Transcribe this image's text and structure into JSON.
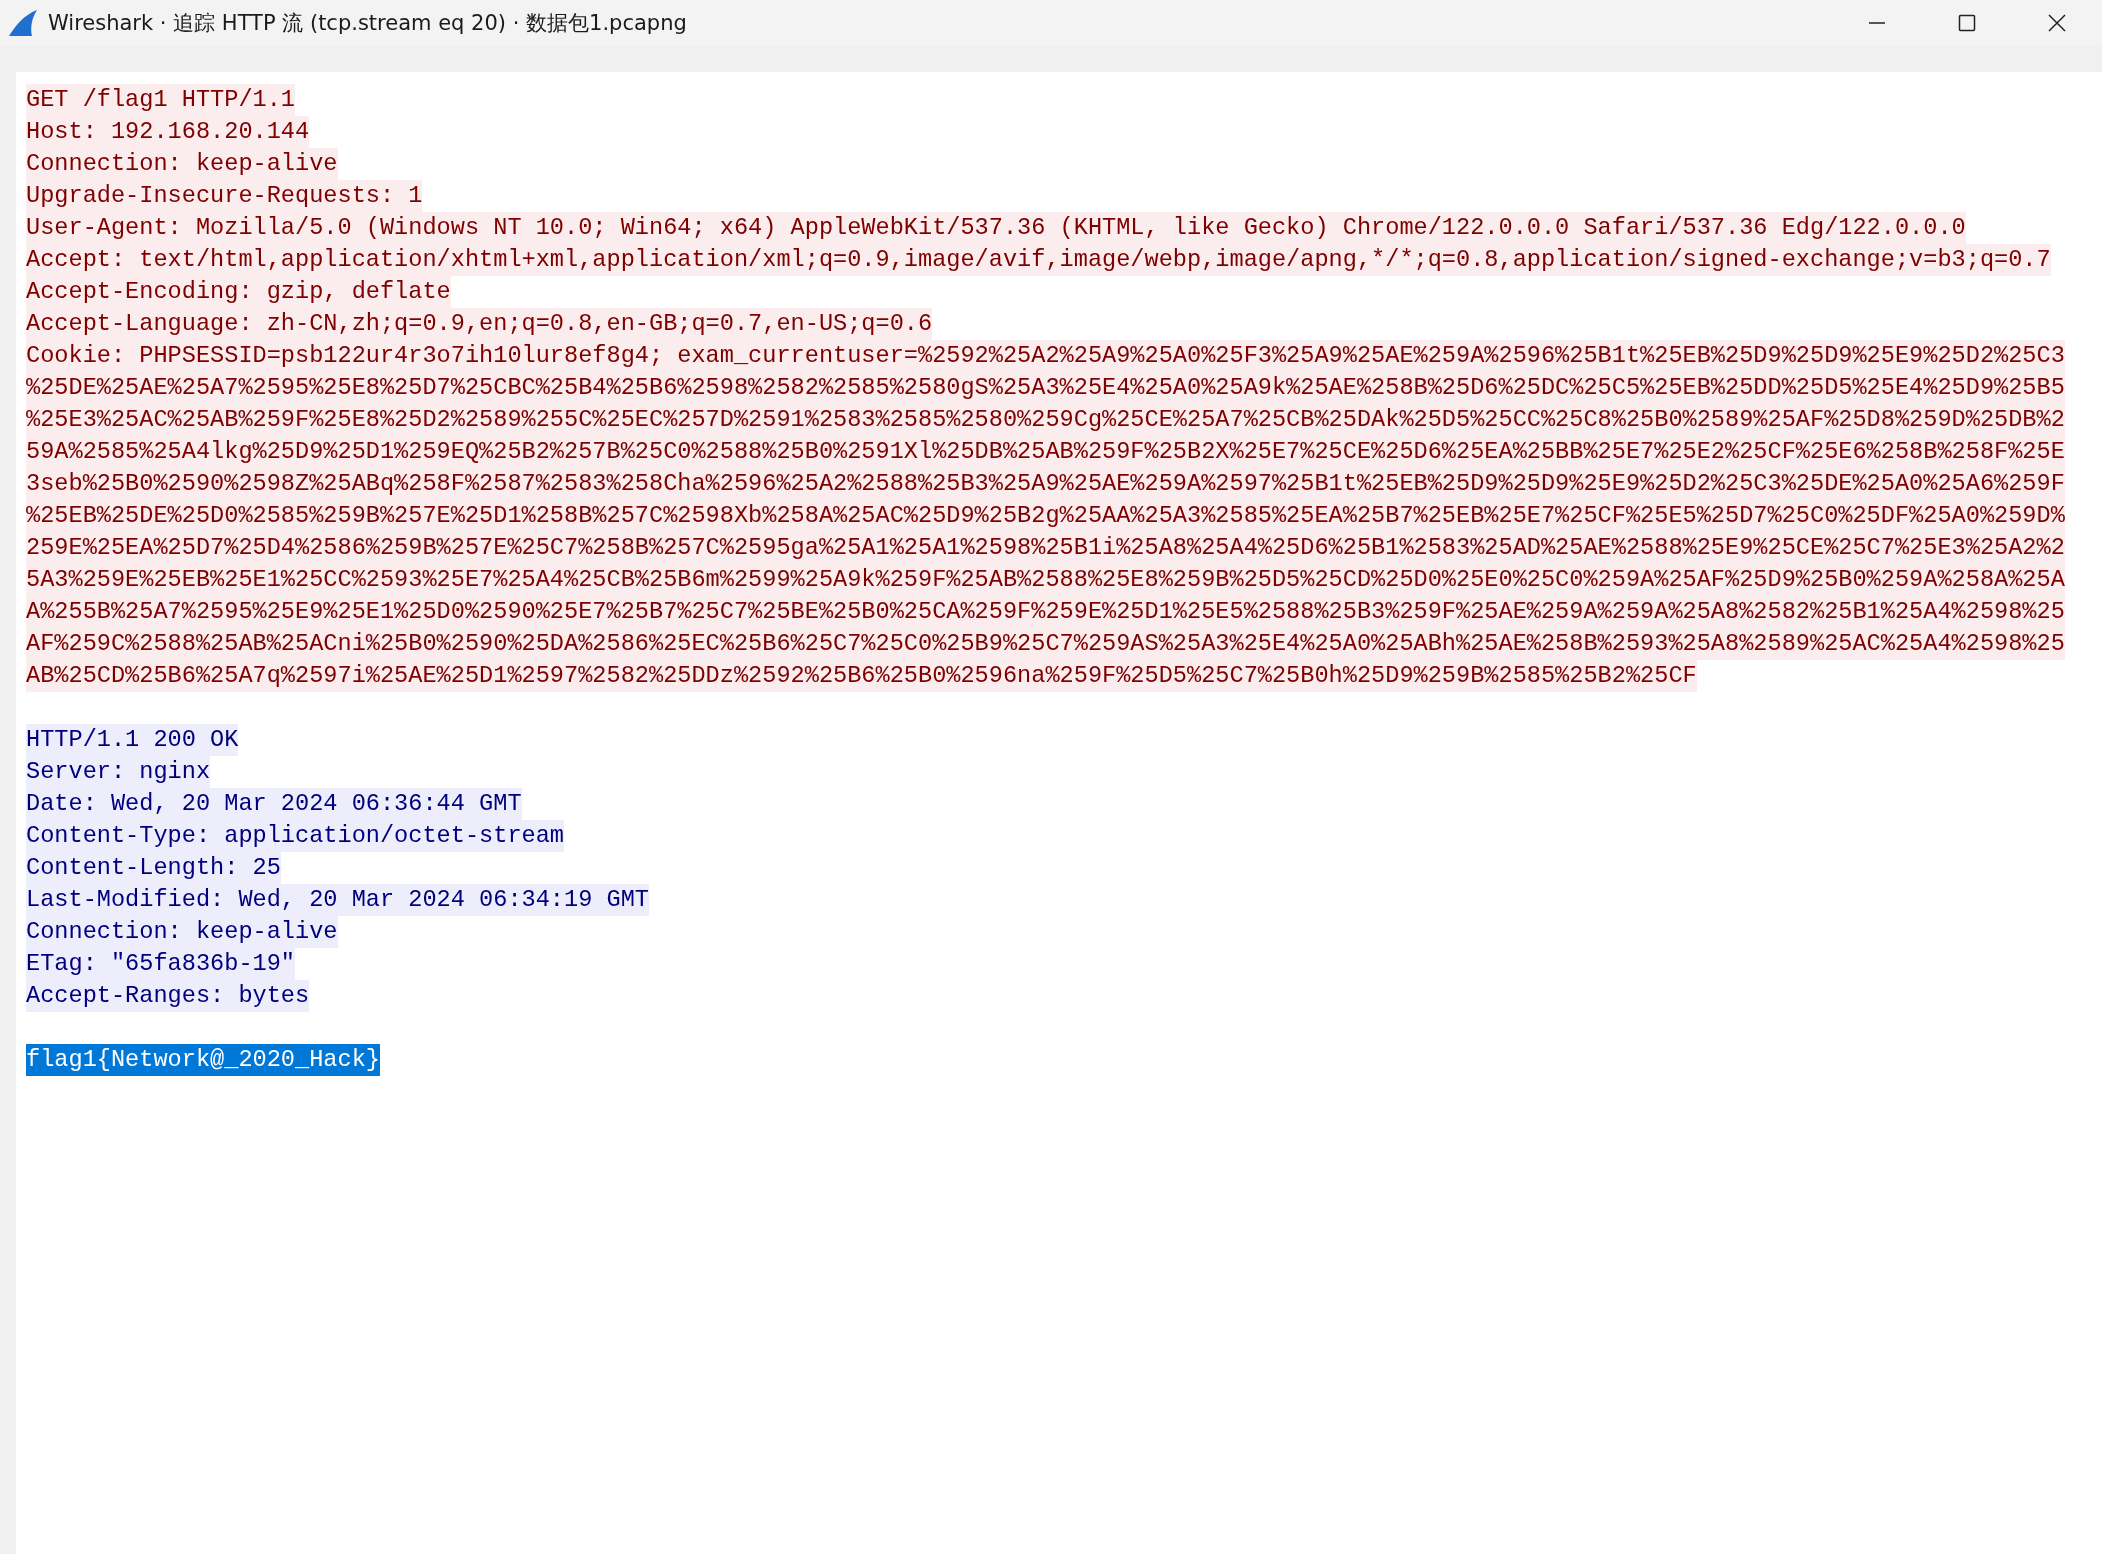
{
  "window": {
    "title": "Wireshark · 追踪 HTTP 流 (tcp.stream eq 20) · 数据包1.pcapng"
  },
  "request_lines": [
    "GET /flag1 HTTP/1.1",
    "Host: 192.168.20.144",
    "Connection: keep-alive",
    "Upgrade-Insecure-Requests: 1",
    "User-Agent: Mozilla/5.0 (Windows NT 10.0; Win64; x64) AppleWebKit/537.36 (KHTML, like Gecko) Chrome/122.0.0.0 Safari/537.36 Edg/122.0.0.0",
    "Accept: text/html,application/xhtml+xml,application/xml;q=0.9,image/avif,image/webp,image/apng,*/*;q=0.8,application/signed-exchange;v=b3;q=0.7",
    "Accept-Encoding: gzip, deflate",
    "Accept-Language: zh-CN,zh;q=0.9,en;q=0.8,en-GB;q=0.7,en-US;q=0.6",
    "Cookie: PHPSESSID=psb122ur4r3o7ih10lur8ef8g4; exam_currentuser=%2592%25A2%25A9%25A0%25F3%25A9%25AE%259A%2596%25B1t%25EB%25D9%25D9%25E9%25D2%25C3",
    "%25DE%25AE%25A7%2595%25E8%25D7%25CBC%25B4%25B6%2598%2582%2585%2580gS%25A3%25E4%25A0%25A9k%25AE%258B%25D6%25DC%25C5%25EB%25DD%25D5%25E4%25D9%25B5",
    "%25E3%25AC%25AB%259F%25E8%25D2%2589%255C%25EC%257D%2591%2583%2585%2580%259Cg%25CE%25A7%25CB%25DAk%25D5%25CC%25C8%25B0%2589%25AF%25D8%259D%25DB%2",
    "59A%2585%25A4lkg%25D9%25D1%259EQ%25B2%257B%25C0%2588%25B0%2591Xl%25DB%25AB%259F%25B2X%25E7%25CE%25D6%25EA%25BB%25E7%25E2%25CF%25E6%258B%258F%25E",
    "3seb%25B0%2590%2598Z%25ABq%258F%2587%2583%258Cha%2596%25A2%2588%25B3%25A9%25AE%259A%2597%25B1t%25EB%25D9%25D9%25E9%25D2%25C3%25DE%25A0%25A6%259F",
    "%25EB%25DE%25D0%2585%259B%257E%25D1%258B%257C%2598Xb%258A%25AC%25D9%25B2g%25AA%25A3%2585%25EA%25B7%25EB%25E7%25CF%25E5%25D7%25C0%25DF%25A0%259D%",
    "259E%25EA%25D7%25D4%2586%259B%257E%25C7%258B%257C%2595ga%25A1%25A1%2598%25B1i%25A8%25A4%25D6%25B1%2583%25AD%25AE%2588%25E9%25CE%25C7%25E3%25A2%2",
    "5A3%259E%25EB%25E1%25CC%2593%25E7%25A4%25CB%25B6m%2599%25A9k%259F%25AB%2588%25E8%259B%25D5%25CD%25D0%25E0%25C0%259A%25AF%25D9%25B0%259A%258A%25A",
    "A%255B%25A7%2595%25E9%25E1%25D0%2590%25E7%25B7%25C7%25BE%25B0%25CA%259F%259E%25D1%25E5%2588%25B3%259F%25AE%259A%259A%25A8%2582%25B1%25A4%2598%25",
    "AF%259C%2588%25AB%25ACni%25B0%2590%25DA%2586%25EC%25B6%25C7%25C0%25B9%25C7%259AS%25A3%25E4%25A0%25ABh%25AE%258B%2593%25A8%2589%25AC%25A4%2598%25",
    "AB%25CD%25B6%25A7q%2597i%25AE%25D1%2597%2582%25DDz%2592%25B6%25B0%2596na%259F%25D5%25C7%25B0h%25D9%259B%2585%25B2%25CF"
  ],
  "response_lines": [
    "HTTP/1.1 200 OK",
    "Server: nginx",
    "Date: Wed, 20 Mar 2024 06:36:44 GMT",
    "Content-Type: application/octet-stream",
    "Content-Length: 25",
    "Last-Modified: Wed, 20 Mar 2024 06:34:19 GMT",
    "Connection: keep-alive",
    "ETag: \"65fa836b-19\"",
    "Accept-Ranges: bytes"
  ],
  "body": {
    "text": "flag1{Network@_2020_Hack}",
    "selected": true
  }
}
